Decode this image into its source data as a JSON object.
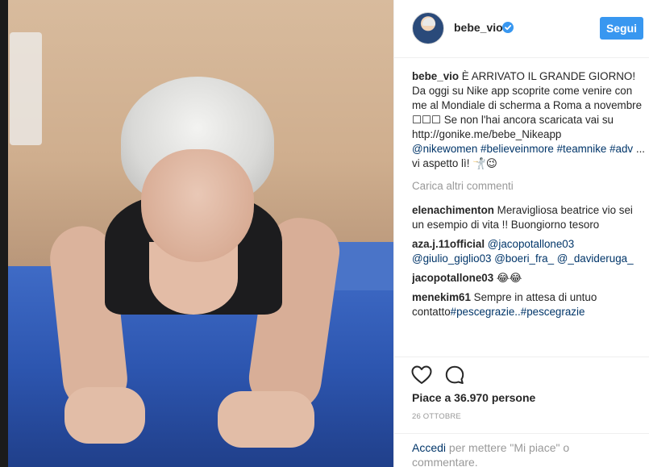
{
  "post": {
    "username": "bebe_vio",
    "follow_label": "Segui",
    "caption": {
      "username": "bebe_vio",
      "text_1": " È ARRIVATO IL GRANDE GIORNO!",
      "text_2": "Da oggi su Nike app scoprite come venire con me al Mondiale di scherma a Roma a novembre ☐☐☐ Se non l'hai ancora scaricata vai su",
      "link_url": "http://gonike.me/bebe_Nikeapp",
      "hashtags": "@nikewomen #believeinmore #teamnike #adv",
      "text_3": " ... vi aspetto lì! 🤺😉"
    },
    "load_more": "Carica altri commenti",
    "comments": [
      {
        "user": "elenachimenton",
        "text": " Meravigliosa beatrice vio sei un esempio di vita !! Buongiorno tesoro",
        "links": ""
      },
      {
        "user": "aza.j.11official",
        "text": "",
        "links": " @jacopotallone03 @giulio_giglio03 @boeri_fra_ @_davideruga_"
      },
      {
        "user": "jacopotallone03",
        "text": " 😂😂",
        "links": ""
      },
      {
        "user": "menekim61",
        "text": " Sempre in attesa di untuo contatto",
        "links": "#pescegrazie..#pescegrazie"
      }
    ],
    "likes": "Piace a 36.970 persone",
    "date": "26 OTTOBRE",
    "login_link": "Accedi",
    "login_text": " per mettere \"Mi piace\" o commentare."
  },
  "icons": {
    "verified": "verified-badge-icon",
    "like": "heart-icon",
    "comment": "comment-bubble-icon"
  },
  "colors": {
    "follow_button": "#3897f0",
    "link": "#003569",
    "verified": "#3897f0",
    "muted": "#999999"
  }
}
